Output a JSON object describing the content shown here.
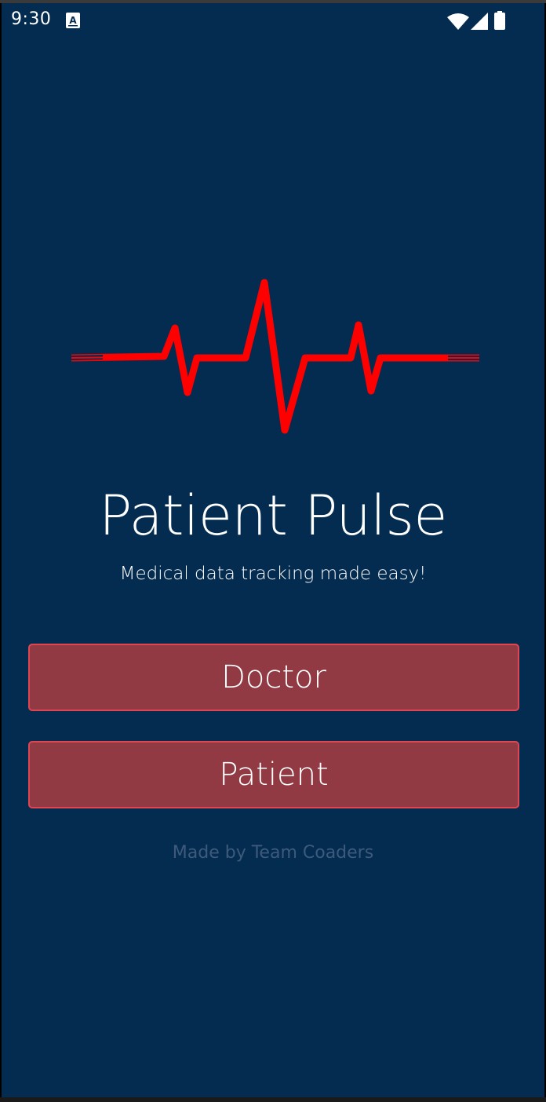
{
  "status_bar": {
    "time": "9:30",
    "icons": [
      "notification-a-icon",
      "wifi-icon",
      "cellular-signal-icon",
      "battery-icon"
    ]
  },
  "logo": {
    "icon": "heartbeat-pulse-icon",
    "color": "#ff0000"
  },
  "app": {
    "title": "Patient Pulse",
    "subtitle": "Medical data tracking made easy!"
  },
  "buttons": {
    "doctor_label": "Doctor",
    "patient_label": "Patient"
  },
  "footer": {
    "credit": "Made by Team Coaders"
  },
  "colors": {
    "background": "#032c50",
    "button_fill": "#913a44",
    "button_border": "#e0464f",
    "footer_text": "#3e5a7a"
  }
}
